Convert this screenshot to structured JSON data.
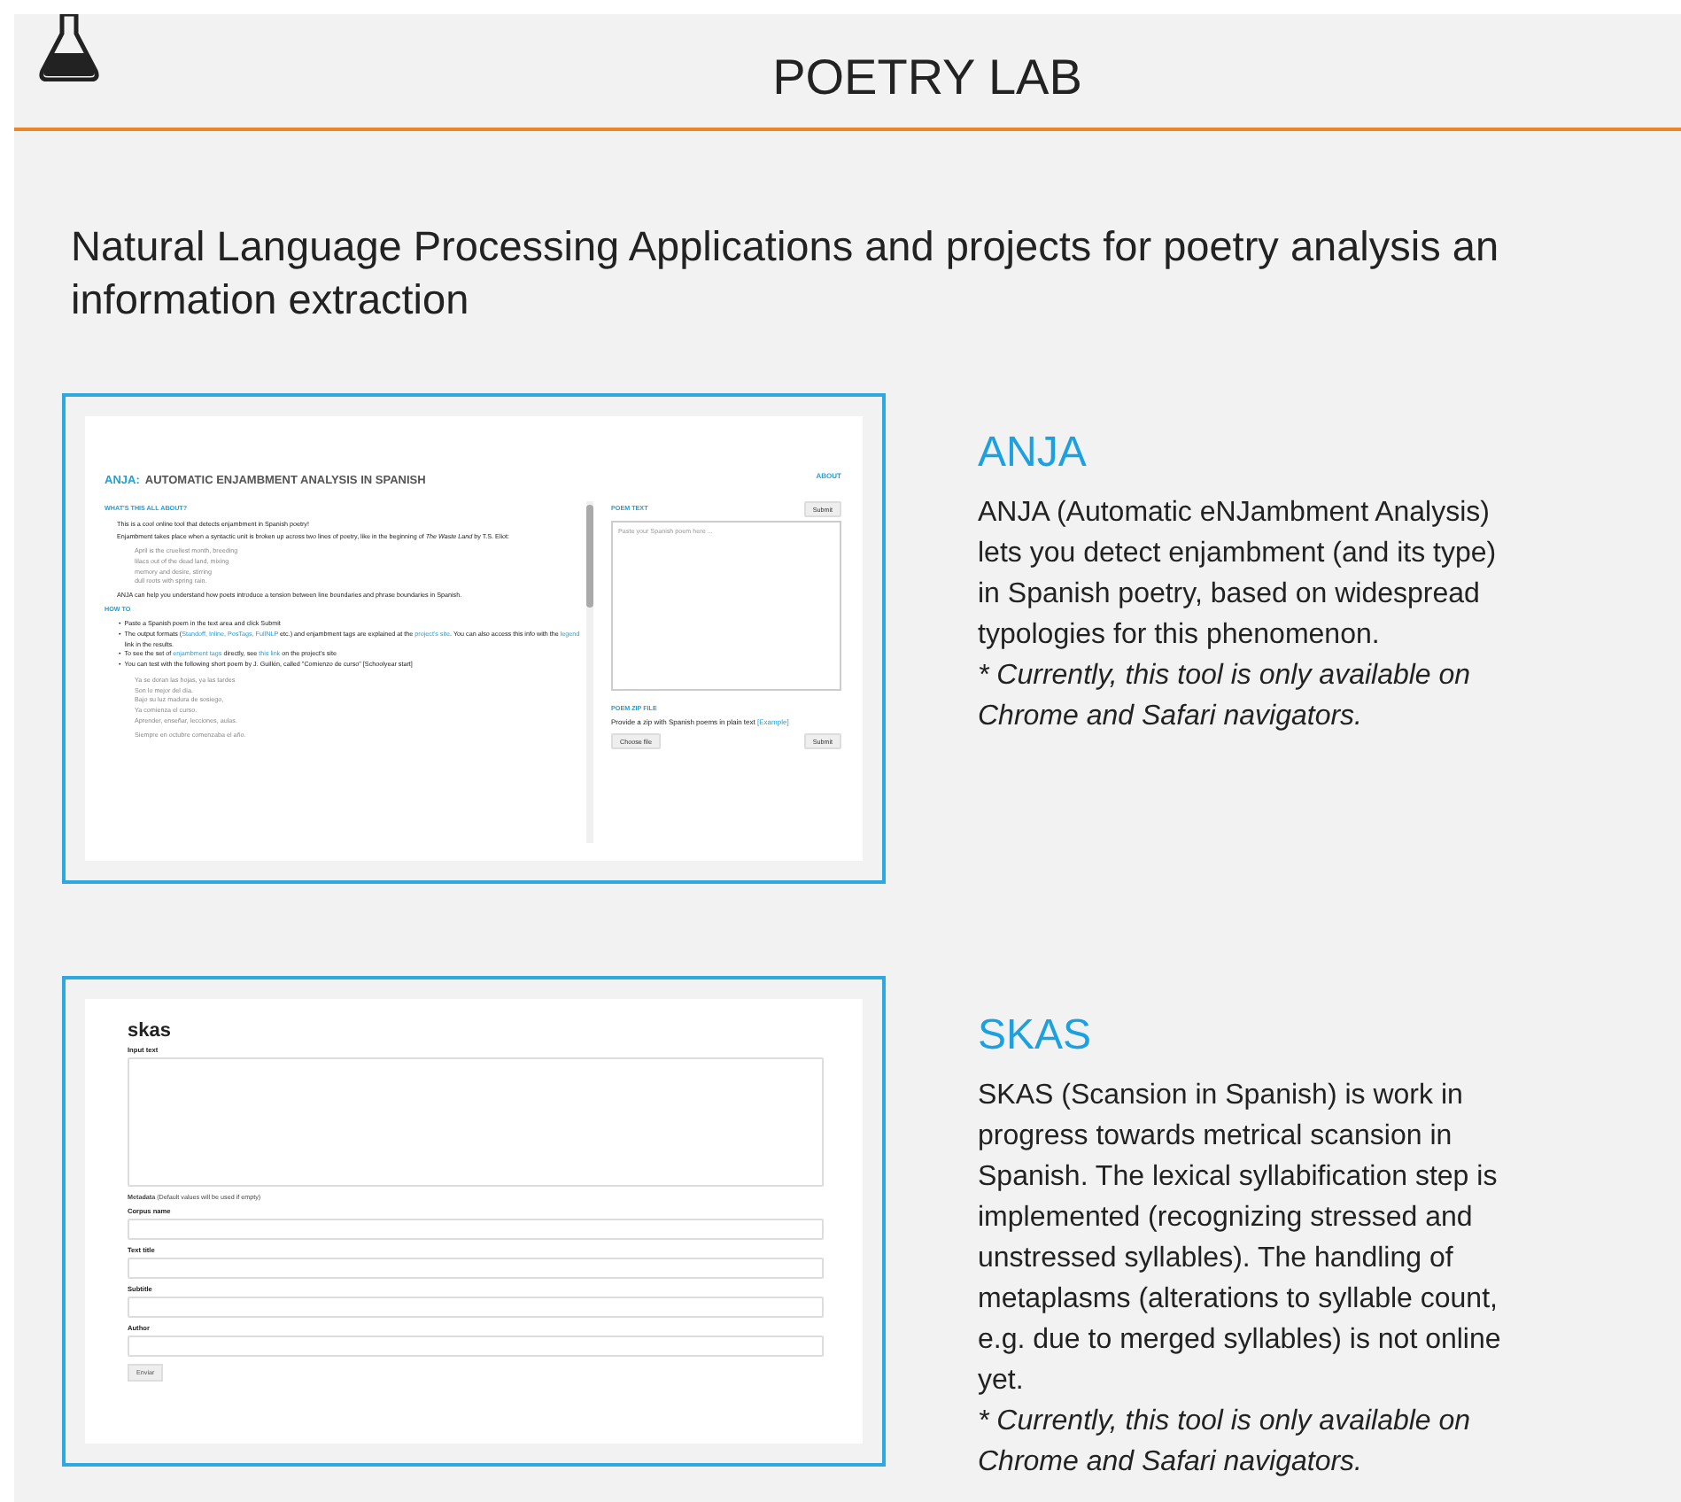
{
  "header": {
    "title": "POETRY LAB"
  },
  "heading": {
    "lines": [
      "Natural Language Processing Applications and projects for poetry analysis an",
      "information extraction"
    ]
  },
  "projects": [
    {
      "kind": "anja",
      "title": "ANJA",
      "description": "ANJA (Automatic eNJambment Analysis) lets you detect enjambment (and its type) in Spanish poetry, based on widespread typologies for this phenomenon.",
      "note": "* Currently, this tool is only available on Chrome and Safari navigators.",
      "preview": {
        "title_prefix": "ANJA:",
        "title": "AUTOMATIC ENJAMBMENT ANALYSIS IN SPANISH",
        "about": "ABOUT",
        "about_section": {
          "label": "WHAT'S THIS ALL ABOUT?",
          "intro": [
            "This is a cool online tool that detects enjambment in Spanish poetry!",
            "Enjambment takes place when a syntactic unit is broken up across two lines of poetry, like in the beginning of *The Waste Land* by T.S. Eliot:"
          ],
          "poem": [
            "April is the cruellest month, breeding",
            "lilacs out of the dead land, mixing",
            "memory and desire, stirring",
            "dull roots with spring rain."
          ],
          "outro": "ANJA can help you understand how poets introduce a tension between line boundaries and phrase boundaries in Spanish."
        },
        "howto": {
          "label": "HOW TO",
          "marker": "•",
          "bullets": [
            [
              {
                "text": "Paste a Spanish poem in the text area and click Submit",
                "link": false
              }
            ],
            [
              {
                "text": "The output formats (",
                "link": false
              },
              {
                "text": "Standoff, Inline, PosTags, FullNLP",
                "link": true
              },
              {
                "text": " etc.) and enjambment tags are explained at the ",
                "link": false
              },
              {
                "text": "project's site",
                "link": true
              },
              {
                "text": ". You can also access this info with the ",
                "link": false
              },
              {
                "text": "legend",
                "link": true
              },
              {
                "text": " link in the results.",
                "link": false
              }
            ],
            [
              {
                "text": "To see the set of ",
                "link": false
              },
              {
                "text": "enjambment tags",
                "link": true
              },
              {
                "text": " directly, see ",
                "link": false
              },
              {
                "text": "this link",
                "link": true
              },
              {
                "text": " on the project's site",
                "link": false
              }
            ],
            [
              {
                "text": "You can test with the following short poem by J. Guillén, called \"Comienzo de curso\" [Schoolyear start]",
                "link": false
              }
            ]
          ],
          "poem": [
            "Ya se doran las hojas, ya las tardes",
            "Son lo mejor del día.",
            "Bajo su luz madura de sosiego,",
            "Ya comienza el curso.",
            "Aprender, enseñar, lecciones, aulas."
          ],
          "poem_last": "Siempre en octubre comenzaba el año."
        },
        "poem_text": {
          "label": "POEM TEXT",
          "button": "Submit",
          "placeholder": "Paste your Spanish poem here ..."
        },
        "zip": {
          "label": "POEM ZIP FILE",
          "hint": "Provide a zip with Spanish poems in plain text",
          "link": "[Example]",
          "file_button": "Choose file",
          "button": "Submit"
        }
      }
    },
    {
      "kind": "skas",
      "title": "SKAS",
      "description": "SKAS (Scansion in Spanish) is work in progress towards metrical scansion in Spanish. The lexical syllabification step is implemented (recognizing stressed and unstressed syllables). The handling of metaplasms (alterations to syllable count, e.g. due to merged syllables) is not online yet.",
      "note": "* Currently, this tool is only available on Chrome and Safari navigators.",
      "preview": {
        "title": "skas",
        "input_label": "Input text",
        "metadata": "**Metadata** (Default values will be used if empty)",
        "fields": [
          "Corpus name",
          "Text title",
          "Subtitle",
          "Author"
        ],
        "button": "Enviar"
      }
    }
  ]
}
